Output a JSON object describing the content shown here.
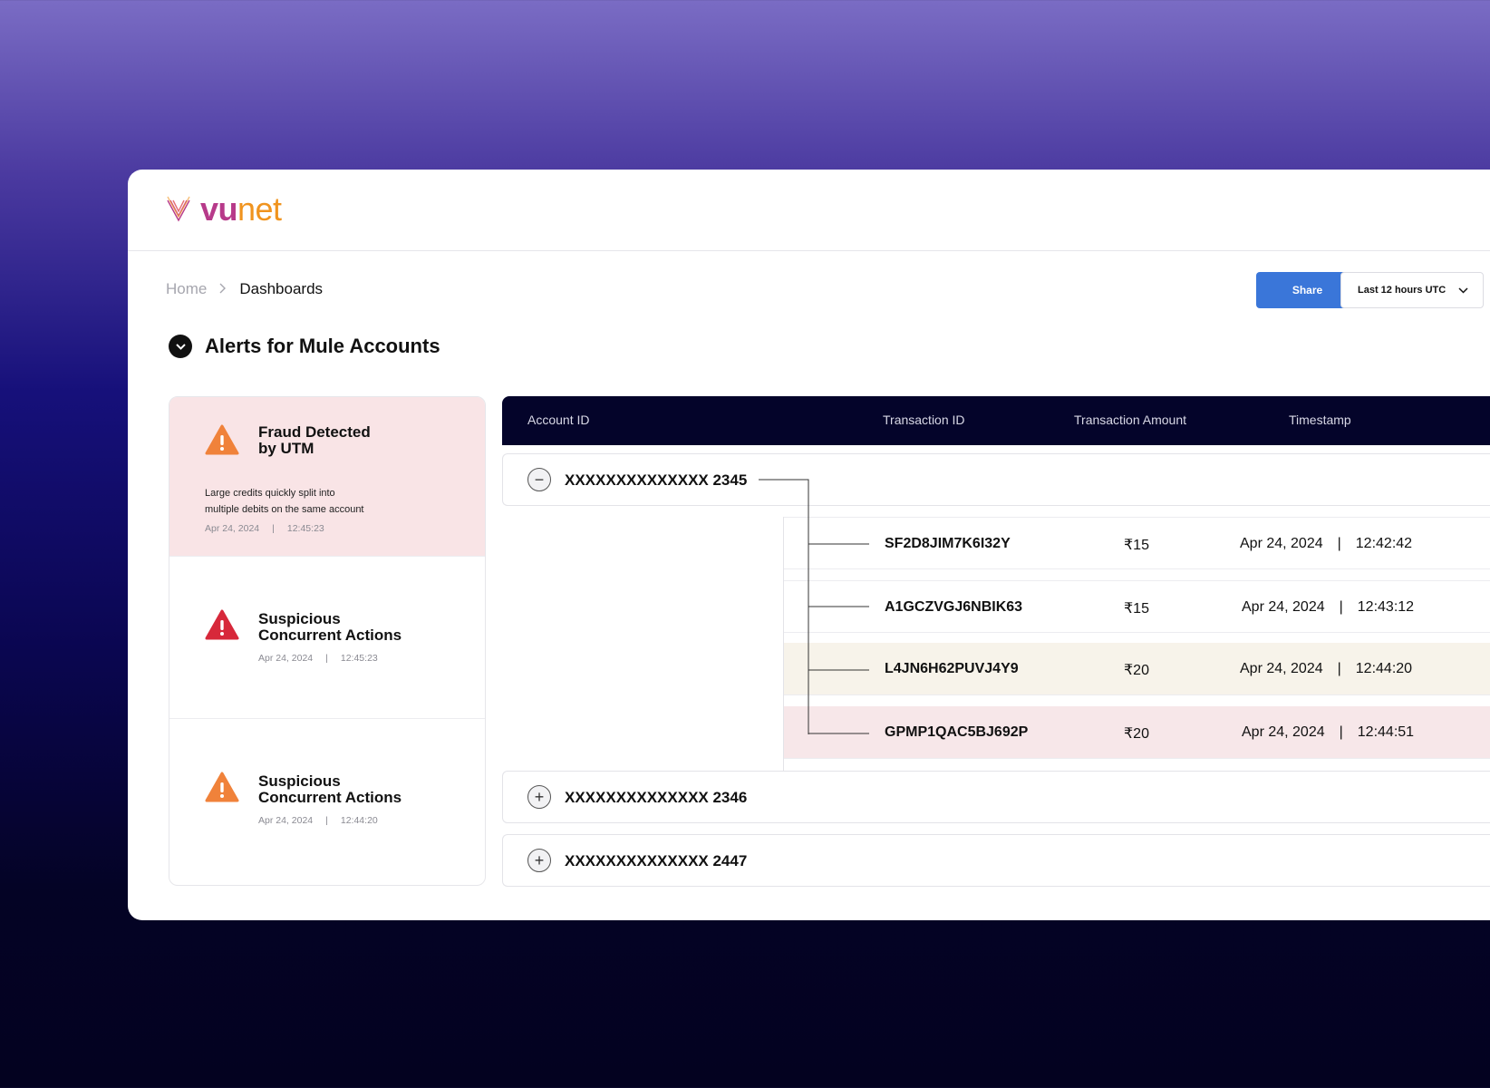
{
  "brand": {
    "name_part1": "vu",
    "name_part2": "net"
  },
  "breadcrumb": {
    "home": "Home",
    "separator": "›",
    "current": "Dashboards"
  },
  "toolbar": {
    "share_label": "Share",
    "time_range": "Last 12 hours UTC"
  },
  "section": {
    "title": "Alerts for Mule Accounts"
  },
  "alerts": [
    {
      "title_line1": "Fraud Detected",
      "title_line2": "by UTM",
      "description_line1": "Large credits quickly split into",
      "description_line2": "multiple debits on the same account",
      "date": "Apr 24, 2024",
      "sep": "|",
      "time": "12:45:23",
      "severity": "warning",
      "color": "#f0823a"
    },
    {
      "title_line1": "Suspicious",
      "title_line2": "Concurrent Actions",
      "date": "Apr 24, 2024",
      "sep": "|",
      "time": "12:45:23",
      "severity": "critical",
      "color": "#d7283a"
    },
    {
      "title_line1": "Suspicious",
      "title_line2": "Concurrent Actions",
      "date": "Apr 24, 2024",
      "sep": "|",
      "time": "12:44:20",
      "severity": "warning",
      "color": "#f0823a"
    }
  ],
  "table": {
    "columns": [
      "Account ID",
      "Transaction ID",
      "Transaction Amount",
      "Timestamp"
    ],
    "accounts": [
      {
        "id": "XXXXXXXXXXXXXX 2345",
        "toggle": "−",
        "expanded": true
      },
      {
        "id": "XXXXXXXXXXXXXX 2346",
        "toggle": "+",
        "expanded": false
      },
      {
        "id": "XXXXXXXXXXXXXX 2447",
        "toggle": "+",
        "expanded": false
      }
    ],
    "transactions": [
      {
        "id": "SF2D8JIM7K6I32Y",
        "amount": "₹15",
        "date": "Apr 24, 2024",
        "sep": "|",
        "time": "12:42:42"
      },
      {
        "id": "A1GCZVGJ6NBIK63",
        "amount": "₹15",
        "date": "Apr 24, 2024",
        "sep": "|",
        "time": "12:43:12"
      },
      {
        "id": "L4JN6H62PUVJ4Y9",
        "amount": "₹20",
        "date": "Apr 24, 2024",
        "sep": "|",
        "time": "12:44:20"
      },
      {
        "id": "GPMP1QAC5BJ692P",
        "amount": "₹20",
        "date": "Apr 24, 2024",
        "sep": "|",
        "time": "12:44:51"
      }
    ]
  },
  "colors": {
    "accent": "#3a76d9",
    "table_header": "#04042a",
    "highlight_beige": "#f7f3ea",
    "highlight_pink": "#f7e7e9"
  }
}
